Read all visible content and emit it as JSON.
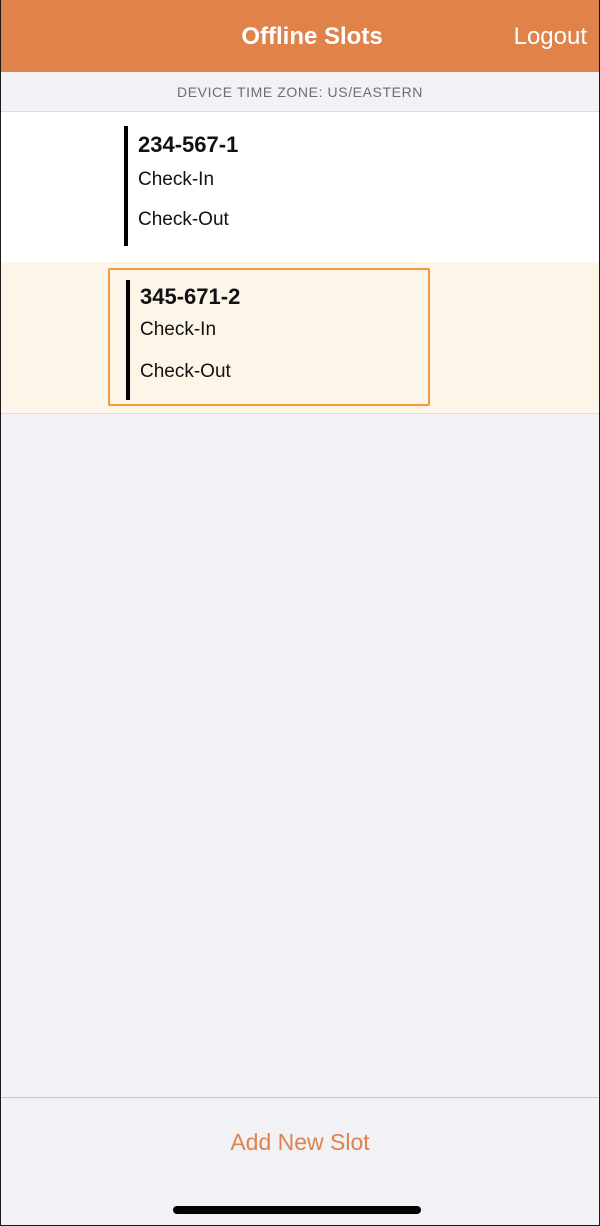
{
  "header": {
    "title": "Offline Slots",
    "logout_label": "Logout"
  },
  "timezone_label": "DEVICE TIME ZONE: US/EASTERN",
  "slots": [
    {
      "id": "234-567-1",
      "checkin_label": "Check-In",
      "checkout_label": "Check-Out",
      "selected": false
    },
    {
      "id": "345-671-2",
      "checkin_label": "Check-In",
      "checkout_label": "Check-Out",
      "selected": true
    }
  ],
  "footer": {
    "add_slot_label": "Add New Slot"
  },
  "colors": {
    "accent": "#e0834a",
    "selected_border": "#f09a3e",
    "selected_background": "#fdf5e8",
    "list_background": "#f2f1f6"
  }
}
